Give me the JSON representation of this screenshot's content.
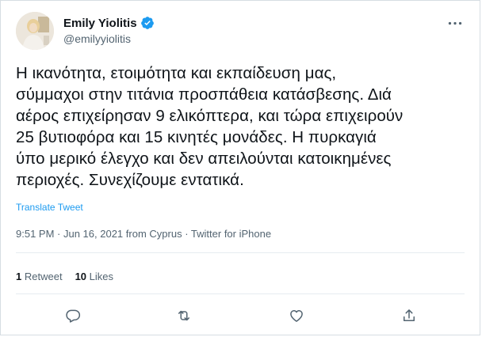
{
  "author": {
    "display_name": "Emily Yiolitis",
    "handle": "@emilyyiolitis",
    "verified": true
  },
  "tweet": {
    "text": "Η ικανότητα, ετοιμότητα και εκπαίδευση μας,\nσύμμαχοι στην τιτάνια προσπάθεια κατάσβεσης. Διά\nαέρος επιχείρησαν 9 ελικόπτερα, και τώρα επιχειρούν\n25 βυτιοφόρα και 15 κινητές μονάδες. Η πυρκαγιά\nύπο μερικό έλεγχο και δεν απειλούνται κατοικημένες\nπεριοχές. Συνεχίζουμε εντατικά.",
    "translate_label": "Translate Tweet",
    "time": "9:51 PM",
    "date": "Jun 16, 2021",
    "location": "from Cyprus",
    "source": "Twitter for iPhone"
  },
  "stats": {
    "retweets_count": "1",
    "retweets_label": "Retweet",
    "likes_count": "10",
    "likes_label": "Likes"
  },
  "icons": {
    "more": "more-horizontal-icon",
    "verified": "verified-badge-icon",
    "reply": "reply-icon",
    "retweet": "retweet-icon",
    "like": "heart-icon",
    "share": "share-icon"
  },
  "colors": {
    "accent": "#1d9bf0",
    "text_primary": "#0f1419",
    "text_secondary": "#536471",
    "border": "#d6dde2"
  }
}
